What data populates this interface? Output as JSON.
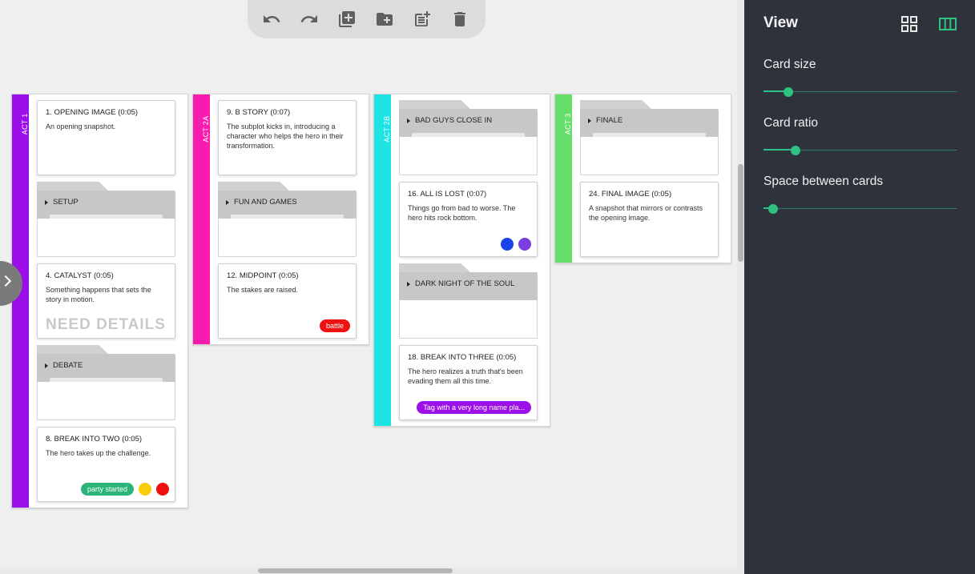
{
  "toolbar": {
    "buttons": [
      {
        "name": "undo-button",
        "icon": "undo-icon"
      },
      {
        "name": "redo-button",
        "icon": "redo-icon"
      },
      {
        "name": "add-library-button",
        "icon": "library-add-icon"
      },
      {
        "name": "new-folder-button",
        "icon": "create-new-folder-icon"
      },
      {
        "name": "add-card-button",
        "icon": "post-add-icon"
      },
      {
        "name": "delete-button",
        "icon": "trash-icon"
      }
    ]
  },
  "acts": [
    {
      "label": "ACT 1",
      "color": "#9b0ee8"
    },
    {
      "label": "ACT 2A",
      "color": "#f71bb0"
    },
    {
      "label": "ACT 2B",
      "color": "#1ee3e3"
    },
    {
      "label": "ACT 3",
      "color": "#64e06a"
    }
  ],
  "cards": {
    "opening_image": {
      "title": "1. OPENING IMAGE (0:05)",
      "text": "An opening snapshot."
    },
    "catalyst": {
      "title": "4. CATALYST (0:05)",
      "text": "Something happens that sets the story in motion.",
      "placeholder": "NEED DETAILS"
    },
    "break_into_two": {
      "title": "8. BREAK INTO TWO (0:05)",
      "text": "The hero takes up the challenge.",
      "tag": "party started"
    },
    "b_story": {
      "title": "9. B STORY (0:07)",
      "text": "The subplot kicks in, introducing a character who helps the hero in their transformation."
    },
    "midpoint": {
      "title": "12. MIDPOINT (0:05)",
      "text": "The stakes are raised.",
      "tag": "battle"
    },
    "all_is_lost": {
      "title": "16. ALL IS LOST (0:07)",
      "text": "Things go from bad to worse. The hero hits rock bottom."
    },
    "break_into_three": {
      "title": "18. BREAK INTO THREE (0:05)",
      "text": "The hero realizes a truth that's been evading them all this time.",
      "tag": "Tag with a very long name pla..."
    },
    "final_image": {
      "title": "24. FINAL IMAGE (0:05)",
      "text": "A snapshot that mirrors or contrasts the opening image."
    }
  },
  "folders": {
    "setup": "SETUP",
    "debate": "DEBATE",
    "fun_and_games": "FUN AND GAMES",
    "bad_guys_close_in": "BAD GUYS CLOSE IN",
    "dark_night": "DARK NIGHT OF THE SOUL",
    "finale": "FINALE"
  },
  "colors": {
    "tag_green": "#2bb57a",
    "tag_red": "#ee1111",
    "tag_purple": "#9b10e8",
    "dot_yellow": "#f7cd0c",
    "dot_red": "#ee1111",
    "dot_blue": "#1a44e8",
    "dot_violet": "#7a3ee0",
    "accent": "#30c080"
  },
  "panel": {
    "title": "View",
    "view_modes": [
      {
        "name": "grid-view-button",
        "icon": "grid-view-icon",
        "active": false
      },
      {
        "name": "column-view-button",
        "icon": "column-view-icon",
        "active": true
      }
    ],
    "settings": [
      {
        "label": "Card size",
        "value": 0.13
      },
      {
        "label": "Card ratio",
        "value": 0.165
      },
      {
        "label": "Space between cards",
        "value": 0.05
      }
    ]
  }
}
